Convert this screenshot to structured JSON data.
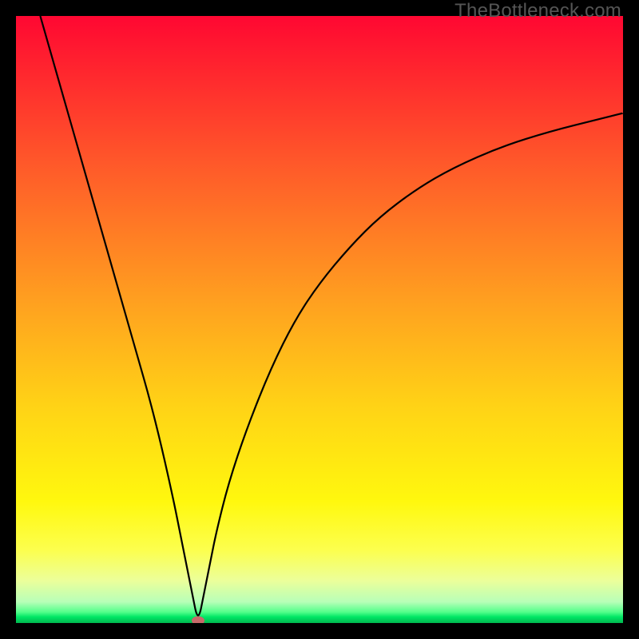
{
  "watermark": "TheBottleneck.com",
  "chart_data": {
    "type": "line",
    "title": "",
    "xlabel": "",
    "ylabel": "",
    "xlim": [
      0,
      100
    ],
    "ylim": [
      0,
      100
    ],
    "grid": false,
    "legend": false,
    "marker": {
      "x": 30,
      "y": 0,
      "color": "#c76a6a"
    },
    "series": [
      {
        "name": "bottleneck-curve",
        "color": "#000000",
        "x": [
          4,
          6,
          8,
          10,
          12,
          14,
          16,
          18,
          20,
          22,
          24,
          26,
          27,
          28,
          29,
          30,
          31,
          32,
          33,
          35,
          38,
          42,
          46,
          50,
          55,
          60,
          66,
          72,
          80,
          88,
          96,
          100
        ],
        "y": [
          100,
          93,
          86,
          79,
          72,
          65,
          58,
          51,
          44,
          37,
          29,
          20,
          15,
          10,
          5,
          0,
          5,
          10,
          15,
          23,
          32,
          42,
          50,
          56,
          62,
          67,
          71.5,
          75,
          78.5,
          81,
          83,
          84
        ]
      }
    ]
  }
}
